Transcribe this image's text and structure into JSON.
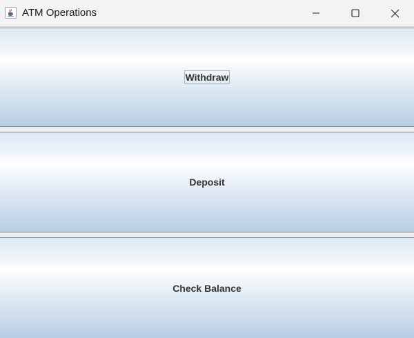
{
  "window": {
    "title": "ATM Operations",
    "icon": "java-cup-icon",
    "controls": [
      "minimize-icon",
      "maximize-icon",
      "close-icon"
    ]
  },
  "buttons": {
    "withdraw": "Withdraw",
    "deposit": "Deposit",
    "check_balance": "Check Balance"
  },
  "colors": {
    "button_gradient_top": "#dde8f3",
    "button_gradient_mid": "#ffffff",
    "button_gradient_bottom": "#b8cde3",
    "label_text": "#333333"
  }
}
